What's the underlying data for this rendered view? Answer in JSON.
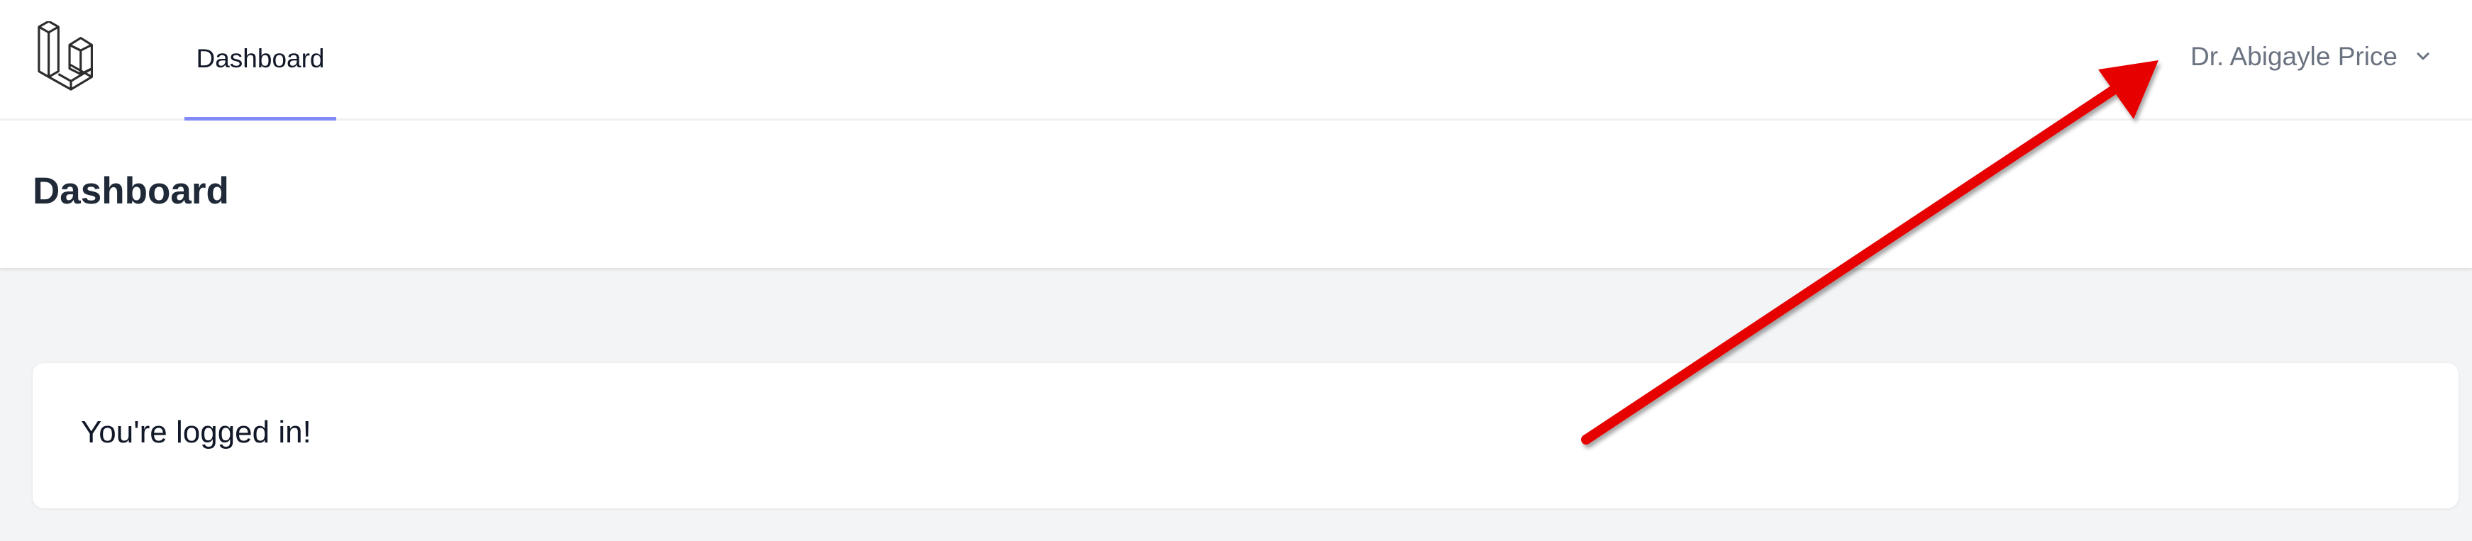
{
  "nav": {
    "logo_icon": "laravel-logo-icon",
    "dashboard_link": "Dashboard",
    "user_name": "Dr. Abigayle Price",
    "user_menu_icon": "chevron-down-icon",
    "active_color": "#818cf8"
  },
  "header": {
    "title": "Dashboard"
  },
  "main": {
    "message": "You're logged in!"
  },
  "annotation": {
    "arrow_icon": "red-arrow-annotation",
    "color": "#e60000"
  }
}
